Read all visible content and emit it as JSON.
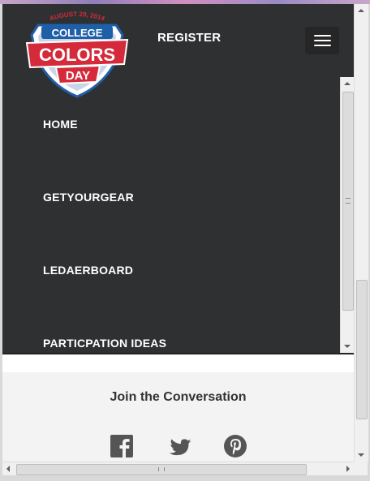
{
  "header": {
    "logo": {
      "date_text": "AUGUST 29, 2014",
      "line1": "COLLEGE",
      "line2": "COLORS",
      "line3": "DAY"
    },
    "register_label": "REGISTER",
    "menu_icon": "hamburger-icon"
  },
  "menu": {
    "items": [
      {
        "label": "HOME"
      },
      {
        "label": "GETYOURGEAR"
      },
      {
        "label": "LEDAERBOARD"
      },
      {
        "label": "PARTICPATION IDEAS"
      }
    ]
  },
  "footer": {
    "heading": "Join the Conversation",
    "social": [
      "facebook-icon",
      "twitter-icon",
      "pinterest-icon"
    ]
  },
  "colors": {
    "header_bg": "#2f3032",
    "menu_text": "#ffffff",
    "footer_bg": "#f3f3f3",
    "logo_blue": "#1f5fa8",
    "logo_red": "#d42a3a",
    "icon_gray": "#555555"
  }
}
